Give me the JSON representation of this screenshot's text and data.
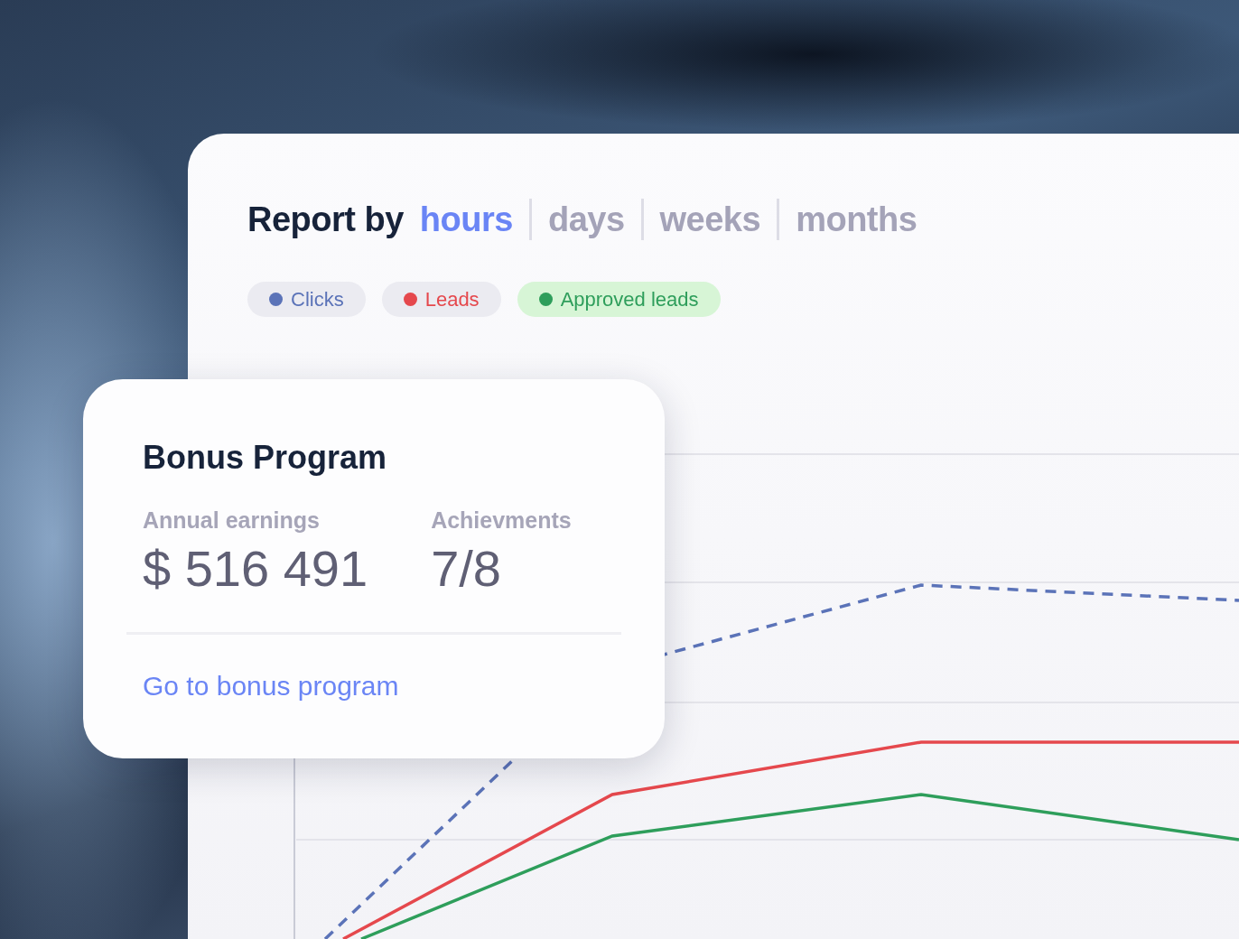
{
  "report": {
    "label": "Report by",
    "periods": [
      {
        "label": "hours",
        "selected": true
      },
      {
        "label": "days",
        "selected": false
      },
      {
        "label": "weeks",
        "selected": false
      },
      {
        "label": "months",
        "selected": false
      }
    ]
  },
  "legend": [
    {
      "label": "Clicks",
      "color": "#5b73b8",
      "selected": false
    },
    {
      "label": "Leads",
      "color": "#e5484d",
      "selected": false
    },
    {
      "label": "Approved leads",
      "color": "#2e9e5b",
      "selected": true
    }
  ],
  "bonus_card": {
    "title": "Bonus Program",
    "stats": [
      {
        "label": "Annual earnings",
        "value": "$ 516 491"
      },
      {
        "label": "Achievments",
        "value": "7/8"
      }
    ],
    "link": "Go to bonus program"
  }
}
